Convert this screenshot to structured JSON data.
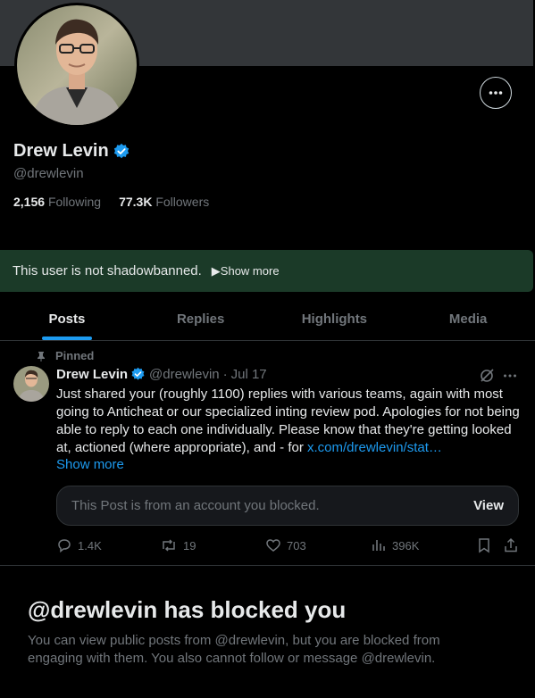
{
  "profile": {
    "name": "Drew Levin",
    "handle": "@drewlevin",
    "following_count": "2,156",
    "following_label": "Following",
    "followers_count": "77.3K",
    "followers_label": "Followers"
  },
  "notice": {
    "text": "This user is not shadowbanned.",
    "show_more": "▶Show more"
  },
  "tabs": [
    {
      "label": "Posts",
      "active": true
    },
    {
      "label": "Replies",
      "active": false
    },
    {
      "label": "Highlights",
      "active": false
    },
    {
      "label": "Media",
      "active": false
    }
  ],
  "post": {
    "pinned_label": "Pinned",
    "author_name": "Drew Levin",
    "author_handle": "@drewlevin",
    "separator": "·",
    "date": "Jul 17",
    "text": "Just shared your (roughly 1100) replies with various teams, again with most going to Anticheat or our specialized inting review pod. Apologies for not being able to reply to each one individually. Please know that they're getting looked at, actioned (where appropriate), and - for ",
    "link": "x.com/drewlevin/stat…",
    "show_more": "Show more",
    "blocked_text": "This Post is from an account you blocked.",
    "view_label": "View",
    "replies": "1.4K",
    "reposts": "19",
    "likes": "703",
    "views": "396K"
  },
  "blocked": {
    "title": "@drewlevin has blocked you",
    "description": "You can view public posts from @drewlevin, but you are blocked from engaging with them. You also cannot follow or message @drewlevin."
  },
  "colors": {
    "background": "#000000",
    "banner": "#333639",
    "accent": "#1d9bf0",
    "notice_bg": "#1b3a28",
    "muted_text": "#71767b"
  }
}
